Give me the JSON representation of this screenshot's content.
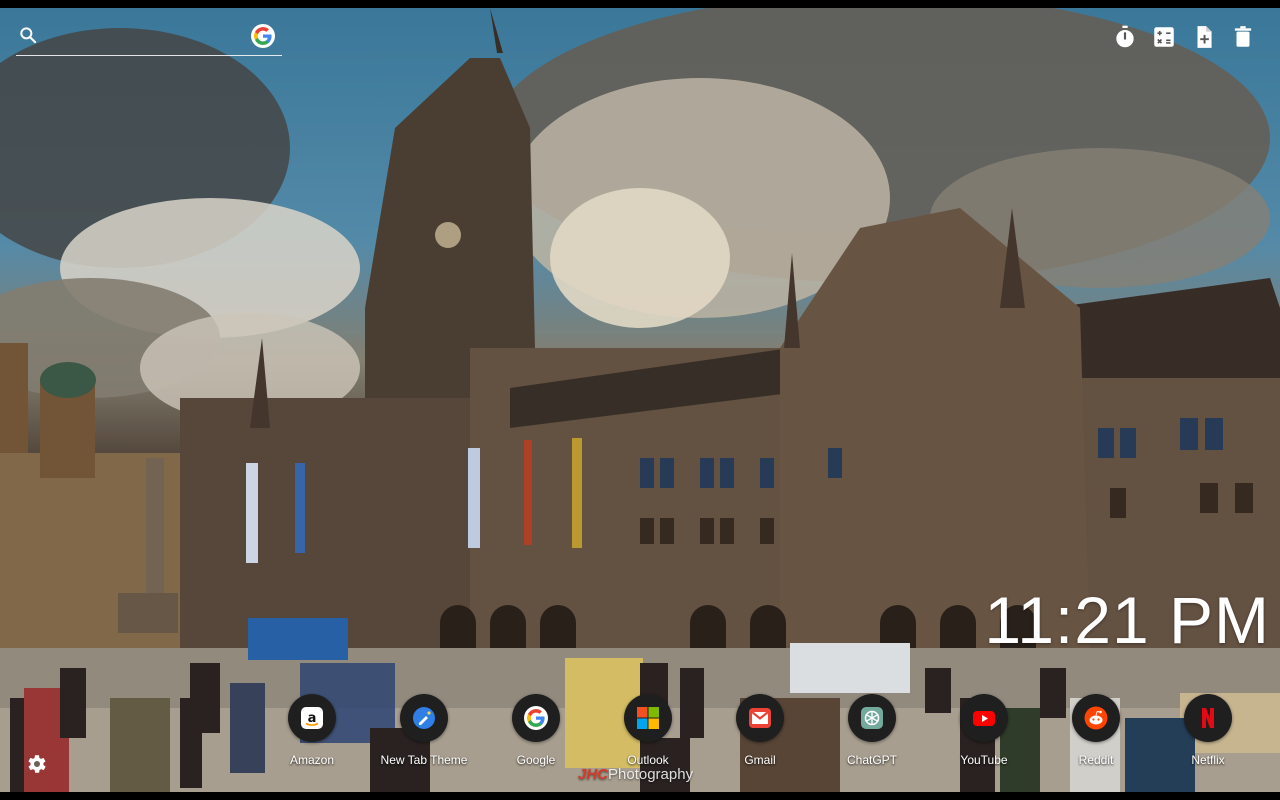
{
  "search": {
    "placeholder": "",
    "value": "",
    "engine_icon": "google-icon"
  },
  "toolbar": [
    {
      "icon": "timer-icon"
    },
    {
      "icon": "calculator-icon"
    },
    {
      "icon": "add-note-icon"
    },
    {
      "icon": "trash-icon"
    }
  ],
  "clock": {
    "time": "11:21 PM"
  },
  "shortcuts": [
    {
      "label": "Amazon",
      "icon": "amazon-icon",
      "color": "#ffffff"
    },
    {
      "label": "New Tab Theme",
      "icon": "new-tab-theme-icon",
      "color": "#2f7fe5"
    },
    {
      "label": "Google",
      "icon": "google-icon",
      "color": "#4285f4"
    },
    {
      "label": "Outlook",
      "icon": "microsoft-icon",
      "color": "#f25022"
    },
    {
      "label": "Gmail",
      "icon": "gmail-icon",
      "color": "#ea4335"
    },
    {
      "label": "ChatGPT",
      "icon": "chatgpt-icon",
      "color": "#74aa9c"
    },
    {
      "label": "YouTube",
      "icon": "youtube-icon",
      "color": "#ff0000"
    },
    {
      "label": "Reddit",
      "icon": "reddit-icon",
      "color": "#ff4500"
    },
    {
      "label": "Netflix",
      "icon": "netflix-icon",
      "color": "#e50914"
    }
  ],
  "watermark": {
    "mark": "JHC",
    "text": "Photography"
  },
  "settings": {
    "icon": "gear-icon"
  }
}
